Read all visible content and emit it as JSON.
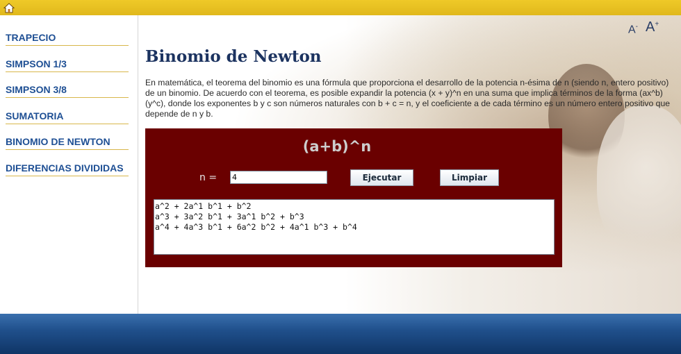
{
  "topbar": {
    "home_icon": "home-icon",
    "accent": "#e6bf22"
  },
  "sidebar": {
    "items": [
      {
        "label": "TRAPECIO"
      },
      {
        "label": "SIMPSON 1/3"
      },
      {
        "label": "SIMPSON 3/8"
      },
      {
        "label": "SUMATORIA"
      },
      {
        "label": "BINOMIO DE NEWTON"
      },
      {
        "label": "DIFERENCIAS DIVIDIDAS"
      }
    ]
  },
  "main": {
    "font_controls": {
      "decrease": "A",
      "decrease_sup": "-",
      "increase": "A",
      "increase_sup": "+"
    },
    "title": "Binomio de Newton",
    "intro": "En matemática, el teorema del binomio es una fórmula que proporciona el desarrollo de la potencia n-ésima de n (siendo n, entero positivo) de un binomio. De acuerdo con el teorema, es posible expandir la potencia (x + y)^n en una suma que implica términos de la forma (ax^b)(y^c), donde los exponentes b y c son números naturales con b + c = n, y el coeficiente a de cada término es un número entero positivo que depende de n y b.",
    "applet": {
      "formula": "(a+b)^n",
      "n_label": "n  =",
      "n_value": "4",
      "execute_label": "Ejecutar",
      "clear_label": "Limpiar",
      "output_lines": [
        "a^2 + 2a^1 b^1 + b^2",
        "a^3 + 3a^2 b^1 + 3a^1 b^2 + b^3",
        "a^4 + 4a^3 b^1 + 6a^2 b^2 + 4a^1 b^3 + b^4"
      ],
      "background": "#6a0000"
    }
  },
  "footer": {
    "color": "#1f4f8c"
  }
}
